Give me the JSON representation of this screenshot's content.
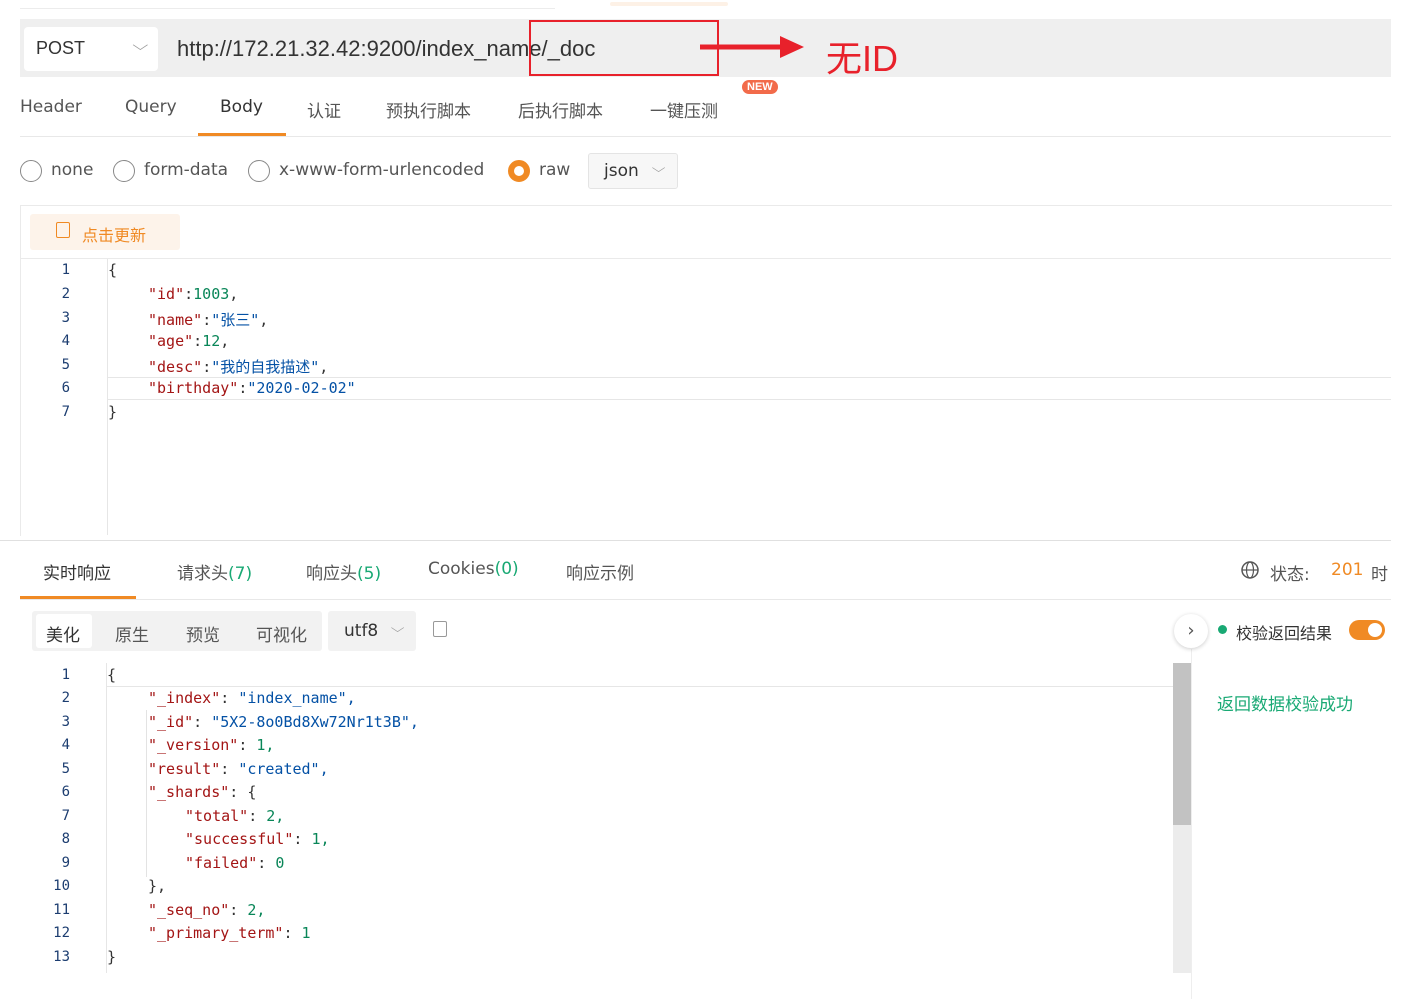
{
  "request": {
    "method": "POST",
    "url": "http://172.21.32.42:9200/index_name/_doc",
    "annotation": "无ID"
  },
  "tabs": [
    "Header",
    "Query",
    "Body",
    "认证",
    "预执行脚本",
    "后执行脚本",
    "一键压测"
  ],
  "new_badge": "NEW",
  "body_types": {
    "none": "none",
    "form_data": "form-data",
    "urlencoded": "x-www-form-urlencoded",
    "raw": "raw",
    "format": "json"
  },
  "update_button": "点击更新",
  "request_body": {
    "line_numbers": [
      "1",
      "2",
      "3",
      "4",
      "5",
      "6",
      "7"
    ],
    "open": "{",
    "close": "}",
    "fields": [
      {
        "key": "\"id\"",
        "value": "1003",
        "sep": ":",
        "trail": ","
      },
      {
        "key": "\"name\"",
        "value": "\"张三\"",
        "sep": ":",
        "trail": ","
      },
      {
        "key": "\"age\"",
        "value": "12",
        "sep": ":",
        "trail": ","
      },
      {
        "key": "\"desc\"",
        "value": "\"我的自我描述\"",
        "sep": ":",
        "trail": ","
      },
      {
        "key": "\"birthday\"",
        "value": "\"2020-02-02\"",
        "sep": ":",
        "trail": ""
      }
    ]
  },
  "response_tabs": {
    "realtime": "实时响应",
    "req_headers": "请求头",
    "req_headers_count": "(7)",
    "resp_headers": "响应头",
    "resp_headers_count": "(5)",
    "cookies": "Cookies",
    "cookies_count": "(0)",
    "example": "响应示例"
  },
  "status": {
    "label": "状态:",
    "code": "201",
    "time_label": "时"
  },
  "format_tabs": [
    "美化",
    "原生",
    "预览",
    "可视化"
  ],
  "encoding": "utf8",
  "verify": {
    "label": "校验返回结果",
    "result": "返回数据校验成功"
  },
  "response_body": {
    "line_numbers": [
      "1",
      "2",
      "3",
      "4",
      "5",
      "6",
      "7",
      "8",
      "9",
      "10",
      "11",
      "12",
      "13"
    ],
    "lines": [
      {
        "key": "",
        "val": "{",
        "vt": "p"
      },
      {
        "key": "\"_index\"",
        "val": "\"index_name\",",
        "vt": "s"
      },
      {
        "key": "\"_id\"",
        "val": "\"5X2-8o0Bd8Xw72Nr1t3B\",",
        "vt": "s"
      },
      {
        "key": "\"_version\"",
        "val": "1,",
        "vt": "n"
      },
      {
        "key": "\"result\"",
        "val": "\"created\",",
        "vt": "s"
      },
      {
        "key": "\"_shards\"",
        "val": "{",
        "vt": "p"
      },
      {
        "key": "\"total\"",
        "val": "2,",
        "vt": "n"
      },
      {
        "key": "\"successful\"",
        "val": "1,",
        "vt": "n"
      },
      {
        "key": "\"failed\"",
        "val": "0",
        "vt": "n"
      },
      {
        "key": "",
        "val": "},",
        "vt": "p"
      },
      {
        "key": "\"_seq_no\"",
        "val": "2,",
        "vt": "n"
      },
      {
        "key": "\"_primary_term\"",
        "val": "1",
        "vt": "n"
      },
      {
        "key": "",
        "val": "}",
        "vt": "p"
      }
    ]
  },
  "colors": {
    "accent": "#f08a24",
    "annotation_red": "#e8212b",
    "success_green": "#19a974"
  }
}
